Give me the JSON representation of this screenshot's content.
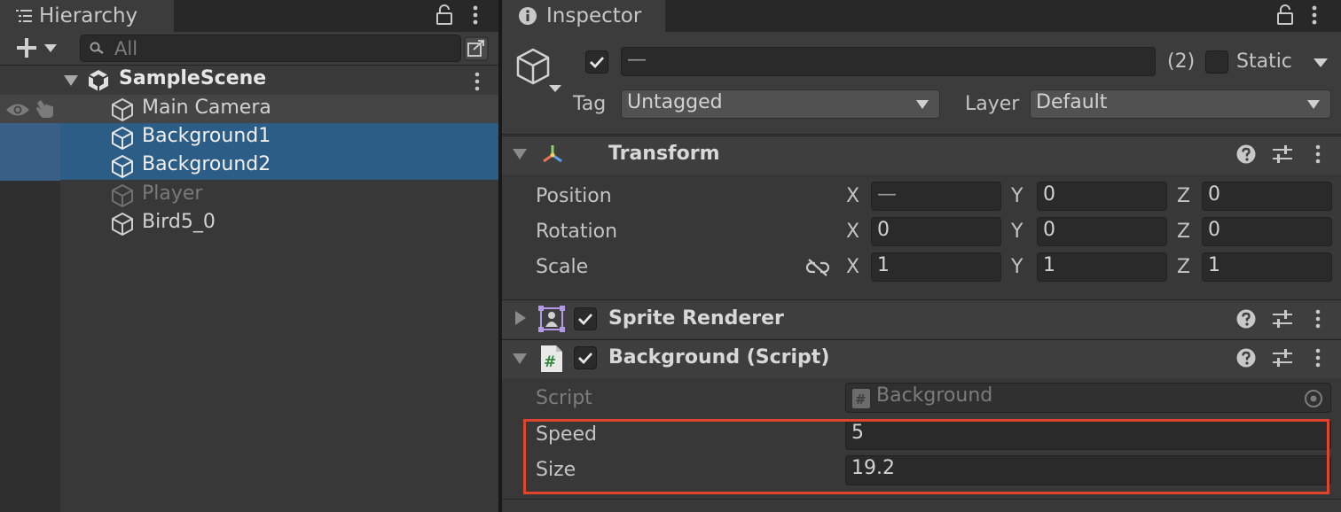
{
  "hierarchy": {
    "tab_title": "Hierarchy",
    "search_placeholder": "All",
    "scene_name": "SampleScene",
    "items": [
      {
        "label": "Main Camera",
        "selected": false,
        "disabled": false
      },
      {
        "label": "Background1",
        "selected": true,
        "disabled": false
      },
      {
        "label": "Background2",
        "selected": true,
        "disabled": false
      },
      {
        "label": "Player",
        "selected": false,
        "disabled": true
      },
      {
        "label": "Bird5_0",
        "selected": false,
        "disabled": false
      }
    ]
  },
  "inspector": {
    "tab_title": "Inspector",
    "object": {
      "name_value": "—",
      "selection_count": "(2)",
      "static_label": "Static",
      "tag_label": "Tag",
      "tag_value": "Untagged",
      "layer_label": "Layer",
      "layer_value": "Default"
    },
    "transform": {
      "title": "Transform",
      "rows": [
        {
          "label": "Position",
          "x": "—",
          "y": "0",
          "z": "0"
        },
        {
          "label": "Rotation",
          "x": "0",
          "y": "0",
          "z": "0"
        },
        {
          "label": "Scale",
          "x": "1",
          "y": "1",
          "z": "1"
        }
      ],
      "axis_labels": [
        "X",
        "Y",
        "Z"
      ]
    },
    "sprite_renderer": {
      "title": "Sprite Renderer"
    },
    "background_script": {
      "title": "Background (Script)",
      "script_label": "Script",
      "script_value": "Background",
      "speed_label": "Speed",
      "speed_value": "5",
      "size_label": "Size",
      "size_value": "19.2"
    }
  },
  "colors": {
    "selection": "#2c5d87",
    "highlight_box": "#e0452b",
    "panel": "#383838"
  }
}
